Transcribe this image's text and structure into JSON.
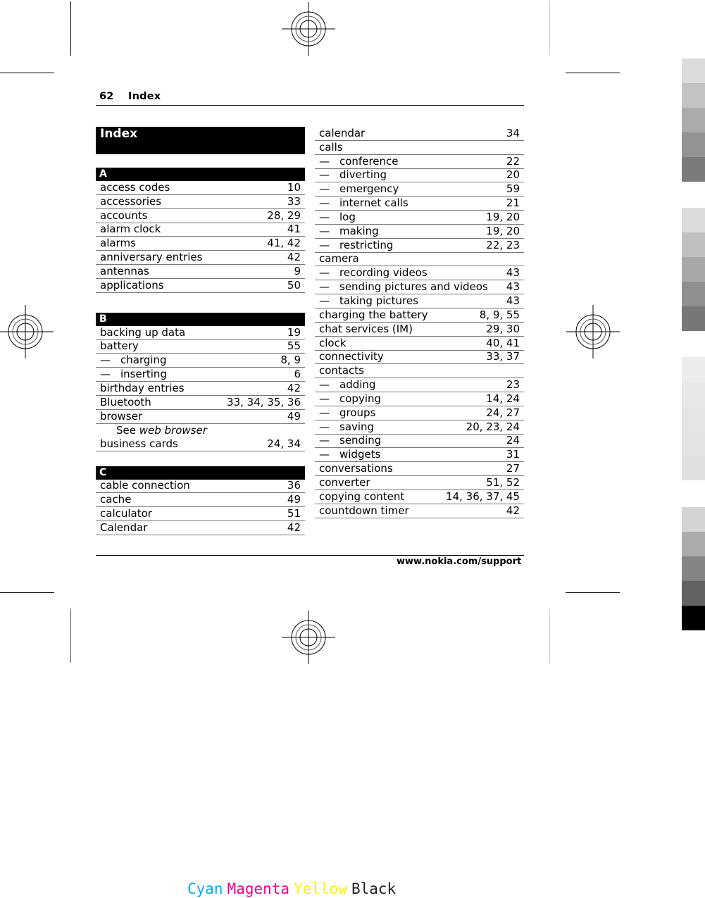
{
  "header": {
    "page_number": "62",
    "section_title": "Index"
  },
  "title": "Index",
  "left_column": {
    "sections": [
      {
        "letter": "A",
        "entries": [
          {
            "term": "access codes",
            "pages": "10"
          },
          {
            "term": "accessories",
            "pages": "33"
          },
          {
            "term": "accounts",
            "pages": "28, 29"
          },
          {
            "term": "alarm clock",
            "pages": "41"
          },
          {
            "term": "alarms",
            "pages": "41, 42"
          },
          {
            "term": "anniversary entries",
            "pages": "42"
          },
          {
            "term": "antennas",
            "pages": "9"
          },
          {
            "term": "applications",
            "pages": "50"
          }
        ]
      },
      {
        "letter": "B",
        "entries": [
          {
            "term": "backing up data",
            "pages": "19"
          },
          {
            "term": "battery",
            "pages": "55"
          },
          {
            "term": "charging",
            "pages": "8, 9",
            "sub": true
          },
          {
            "term": "inserting",
            "pages": "6",
            "sub": true
          },
          {
            "term": "birthday entries",
            "pages": "42"
          },
          {
            "term": "Bluetooth",
            "pages": "33, 34, 35, 36"
          },
          {
            "term": "browser",
            "pages": "49"
          },
          {
            "see_prefix": "See",
            "see_target": "web browser"
          },
          {
            "term": "business cards",
            "pages": "24, 34"
          }
        ]
      },
      {
        "letter": "C",
        "entries": [
          {
            "term": "cable connection",
            "pages": "36"
          },
          {
            "term": "cache",
            "pages": "49"
          },
          {
            "term": "calculator",
            "pages": "51"
          },
          {
            "term": "Calendar",
            "pages": "42"
          }
        ]
      }
    ]
  },
  "right_column": {
    "entries": [
      {
        "term": "calendar",
        "pages": "34"
      },
      {
        "term": "calls",
        "pages": ""
      },
      {
        "term": "conference",
        "pages": "22",
        "sub": true
      },
      {
        "term": "diverting",
        "pages": "20",
        "sub": true
      },
      {
        "term": "emergency",
        "pages": "59",
        "sub": true
      },
      {
        "term": "internet calls",
        "pages": "21",
        "sub": true
      },
      {
        "term": "log",
        "pages": "19, 20",
        "sub": true
      },
      {
        "term": "making",
        "pages": "19, 20",
        "sub": true
      },
      {
        "term": "restricting",
        "pages": "22, 23",
        "sub": true
      },
      {
        "term": "camera",
        "pages": ""
      },
      {
        "term": "recording videos",
        "pages": "43",
        "sub": true
      },
      {
        "term": "sending pictures and videos",
        "pages": "43",
        "sub": true
      },
      {
        "term": "taking pictures",
        "pages": "43",
        "sub": true
      },
      {
        "term": "charging the battery",
        "pages": "8, 9, 55"
      },
      {
        "term": "chat services (IM)",
        "pages": "29, 30"
      },
      {
        "term": "clock",
        "pages": "40, 41"
      },
      {
        "term": "connectivity",
        "pages": "33, 37"
      },
      {
        "term": "contacts",
        "pages": ""
      },
      {
        "term": "adding",
        "pages": "23",
        "sub": true
      },
      {
        "term": "copying",
        "pages": "14, 24",
        "sub": true
      },
      {
        "term": "groups",
        "pages": "24, 27",
        "sub": true
      },
      {
        "term": "saving",
        "pages": "20, 23, 24",
        "sub": true
      },
      {
        "term": "sending",
        "pages": "24",
        "sub": true
      },
      {
        "term": "widgets",
        "pages": "31",
        "sub": true
      },
      {
        "term": "conversations",
        "pages": "27"
      },
      {
        "term": "converter",
        "pages": "51, 52"
      },
      {
        "term": "copying content",
        "pages": "14, 36, 37, 45"
      },
      {
        "term": "countdown timer",
        "pages": "42"
      }
    ]
  },
  "footer": {
    "url": "www.nokia.com/support"
  },
  "print_marks": {
    "color_bars": {
      "group1": [
        "#dcdcdc",
        "#c3c3c3",
        "#ababab",
        "#939393",
        "#7b7b7b"
      ],
      "group2": [
        "#dcdcdc",
        "#c0c0c0",
        "#a8a8a8",
        "#8f8f8f",
        "#777777"
      ],
      "group3": [
        "#ececec",
        "#e8e8e8",
        "#e5e5e5",
        "#e3e3e3",
        "#e0e0e0"
      ],
      "group4": [
        "#d4d4d4",
        "#ababab",
        "#848484",
        "#626262",
        "#000000"
      ]
    },
    "separations": [
      {
        "label": "Cyan",
        "color": "#00aeef"
      },
      {
        "label": "Magenta",
        "color": "#ec008c"
      },
      {
        "label": "Yellow",
        "color": "#fff200"
      },
      {
        "label": "Black",
        "color": "#231f20"
      }
    ]
  }
}
